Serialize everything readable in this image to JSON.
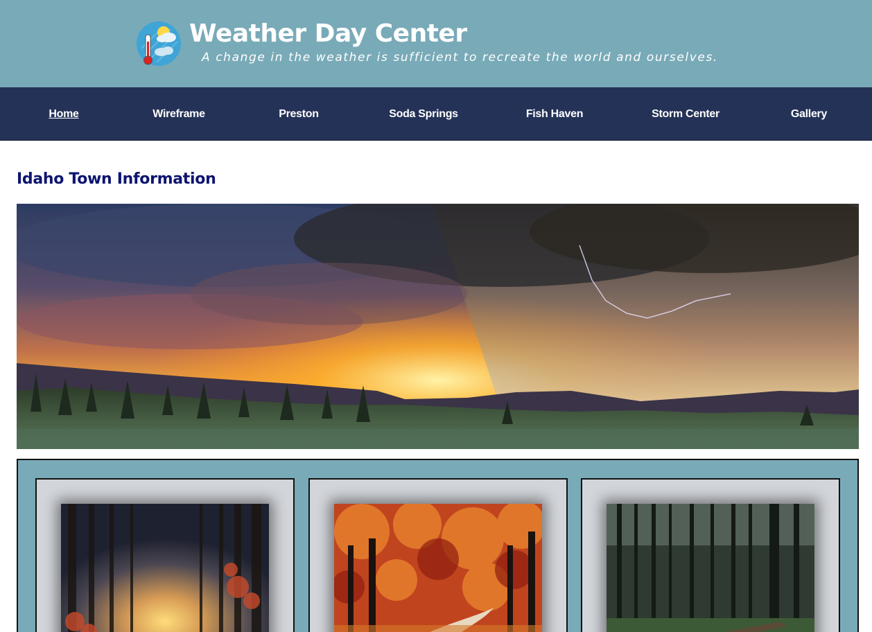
{
  "site": {
    "title": "Weather Day Center",
    "tagline": "A change in the weather is sufficient to recreate the world and ourselves.",
    "logo_icon": "thermometer-sun-cloud-icon"
  },
  "nav": {
    "items": [
      {
        "label": "Home",
        "active": true
      },
      {
        "label": "Wireframe",
        "active": false
      },
      {
        "label": "Preston",
        "active": false
      },
      {
        "label": "Soda Springs",
        "active": false
      },
      {
        "label": "Fish Haven",
        "active": false
      },
      {
        "label": "Storm Center",
        "active": false
      },
      {
        "label": "Gallery",
        "active": false
      }
    ]
  },
  "main": {
    "heading": "Idaho Town Information",
    "hero_image": "stormy-sunset-landscape",
    "cards": [
      {
        "image": "foggy-autumn-forest-path"
      },
      {
        "image": "red-autumn-trees-road"
      },
      {
        "image": "dark-pine-forest-trail"
      }
    ]
  },
  "colors": {
    "header_bg": "#79aab8",
    "nav_bg": "#243257",
    "heading": "#0d1470",
    "card_bg": "#d2d5da"
  }
}
